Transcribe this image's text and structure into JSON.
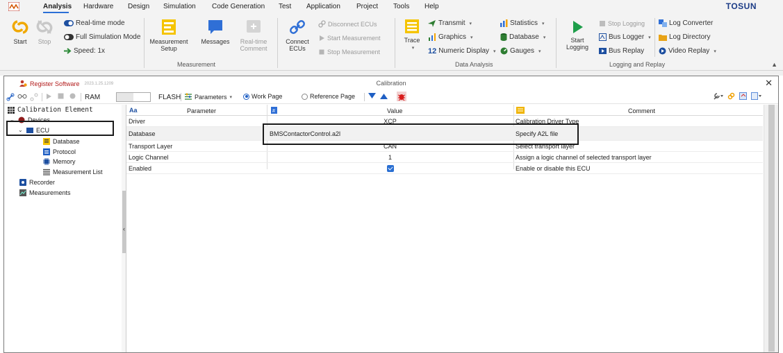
{
  "menu": {
    "items": [
      "Analysis",
      "Hardware",
      "Design",
      "Simulation",
      "Code Generation",
      "Test",
      "Application",
      "Project",
      "Tools",
      "Help"
    ],
    "active_index": 0,
    "brand": "TOSUN"
  },
  "ribbon": {
    "start": "Start",
    "stop": "Stop",
    "realtime_mode": "Real-time mode",
    "full_sim_mode": "Full Simulation Mode",
    "speed": "Speed: 1x",
    "measurement_setup": [
      "Measurement",
      "Setup"
    ],
    "messages": "Messages",
    "realtime_comment": [
      "Real-time",
      "Comment"
    ],
    "measurement_group": "Measurement",
    "connect_ecus": [
      "Connect",
      "ECUs"
    ],
    "disconnect_ecus": "Disconnect ECUs",
    "start_measurement": "Start Measurement",
    "stop_measurement": "Stop Measurement",
    "trace": "Trace",
    "transmit": "Transmit",
    "graphics": "Graphics",
    "numeric_display": "Numeric Display",
    "statistics": "Statistics",
    "database": "Database",
    "gauges": "Gauges",
    "data_analysis_group": "Data Analysis",
    "start_logging": [
      "Start",
      "Logging"
    ],
    "stop_logging": "Stop Logging",
    "bus_logger": "Bus Logger",
    "bus_replay": "Bus Replay",
    "log_converter": "Log Converter",
    "log_directory": "Log Directory",
    "video_replay": "Video Replay",
    "logging_group": "Logging and Replay"
  },
  "window": {
    "register": "Register Software",
    "version": "2023.1.25.1209",
    "title": "Calibration",
    "close": "✕"
  },
  "toolbar": {
    "ram": "RAM",
    "flash": "FLASH",
    "parameters": "Parameters",
    "work_page": "Work Page",
    "reference_page": "Reference Page"
  },
  "tree": {
    "root": "Calibration Element",
    "devices": "Devices",
    "ecu": "ECU",
    "database": "Database",
    "protocol": "Protocol",
    "memory": "Memory",
    "measurement_list": "Measurement List",
    "recorder": "Recorder",
    "measurements": "Measurements"
  },
  "grid": {
    "headers": {
      "parameter": "Parameter",
      "value": "Value",
      "comment": "Comment"
    },
    "rows": [
      {
        "parameter": "Driver",
        "value": "XCP",
        "comment": "Calibration Driver Type"
      },
      {
        "parameter": "Database",
        "value": "BMSContactorControl.a2l",
        "comment": "Specify A2L file"
      },
      {
        "parameter": "Transport Layer",
        "value": "CAN",
        "comment": "Select transport layer"
      },
      {
        "parameter": "Logic Channel",
        "value": "1",
        "comment": "Assign a logic channel of selected transport layer"
      },
      {
        "parameter": "Enabled",
        "value": "",
        "checked": true,
        "comment": "Enable or disable this ECU"
      }
    ]
  }
}
